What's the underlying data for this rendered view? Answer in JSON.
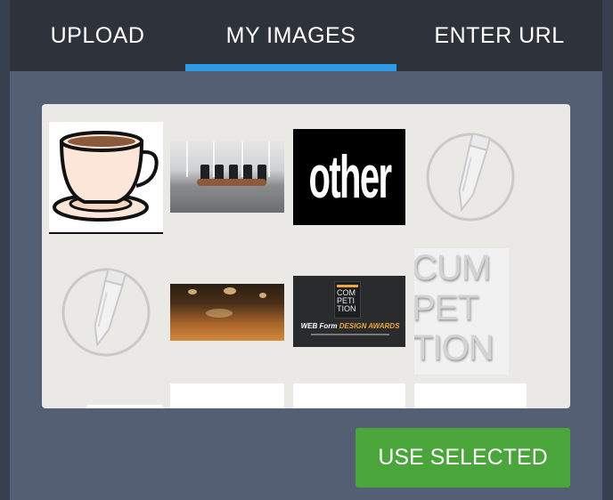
{
  "tabs": [
    {
      "label": "UPLOAD",
      "active": false
    },
    {
      "label": "MY IMAGES",
      "active": true
    },
    {
      "label": "ENTER URL",
      "active": false
    }
  ],
  "accent_color": "#2d9be6",
  "button_color": "#4aa63b",
  "gallery": {
    "images": [
      {
        "name": "coffee-cup-image",
        "alt": "coffee cup"
      },
      {
        "name": "conference-room-image",
        "alt": "conference room"
      },
      {
        "name": "other-logo-image",
        "text": "other"
      },
      {
        "name": "placeholder-pencil-image",
        "icon": "pencil-icon"
      },
      {
        "name": "placeholder-pencil-image",
        "icon": "pencil-icon"
      },
      {
        "name": "crowd-concert-image",
        "alt": "crowd"
      },
      {
        "name": "competition-dark-image",
        "tile_lines": [
          "COM",
          "PETI",
          "TION"
        ],
        "caption_plain": "WEB Form ",
        "caption_accent": "DESIGN AWARDS"
      },
      {
        "name": "competition-text-image",
        "lines": [
          "CUM",
          "PET",
          "TION"
        ]
      }
    ]
  },
  "footer": {
    "use_selected_label": "USE SELECTED"
  }
}
